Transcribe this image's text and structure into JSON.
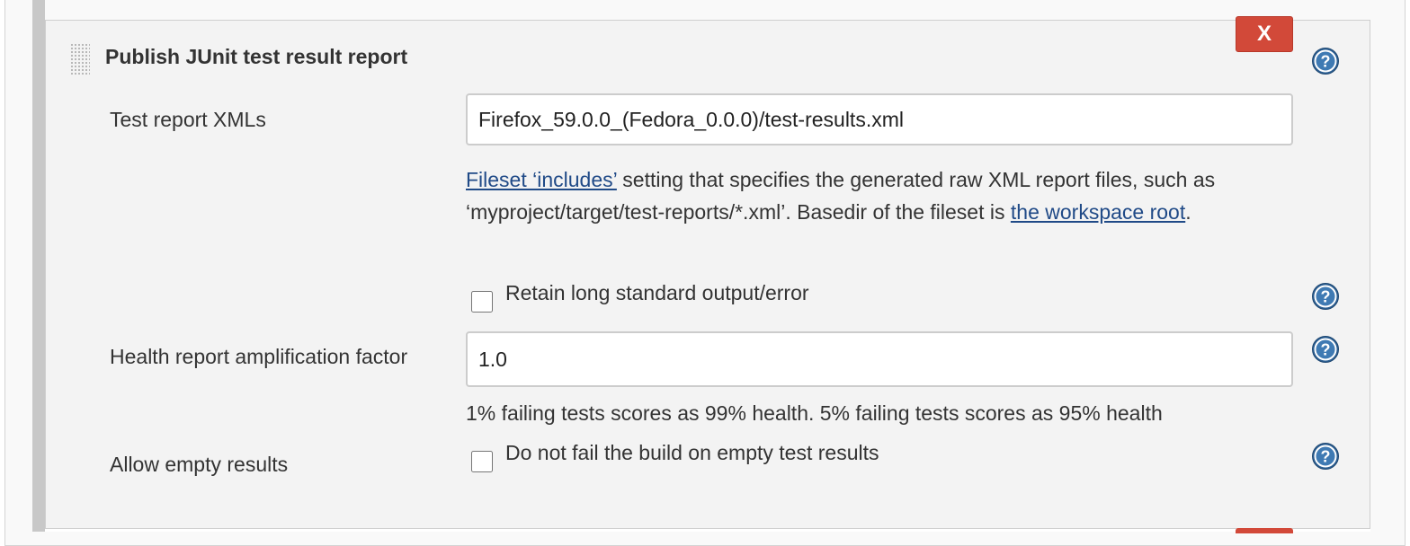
{
  "section": {
    "title": "Publish JUnit test result report",
    "delete_label": "X"
  },
  "fields": {
    "test_report_xmls": {
      "label": "Test report XMLs",
      "value": "Firefox_59.0.0_(Fedora_0.0.0)/test-results.xml",
      "help": {
        "link1": "Fileset ‘includes’",
        "text1": " setting that specifies the generated raw XML report files, such as ‘myproject/target/test-reports/*.xml’. Basedir of the fileset is ",
        "link2": "the workspace root",
        "text2": "."
      }
    },
    "retain_output": {
      "label": "Retain long standard output/error",
      "checked": false
    },
    "health_factor": {
      "label": "Health report amplification factor",
      "value": "1.0",
      "help": "1% failing tests scores as 99% health. 5% failing tests scores as 95% health"
    },
    "allow_empty": {
      "label": "Allow empty results",
      "checkbox_label": "Do not fail the build on empty test results",
      "checked": false
    }
  },
  "icons": {
    "help": "help-icon",
    "drag": "drag-handle-icon",
    "delete": "delete-button"
  },
  "colors": {
    "delete_red": "#d24939",
    "link_blue": "#204a87",
    "help_blue": "#2c5f93"
  }
}
